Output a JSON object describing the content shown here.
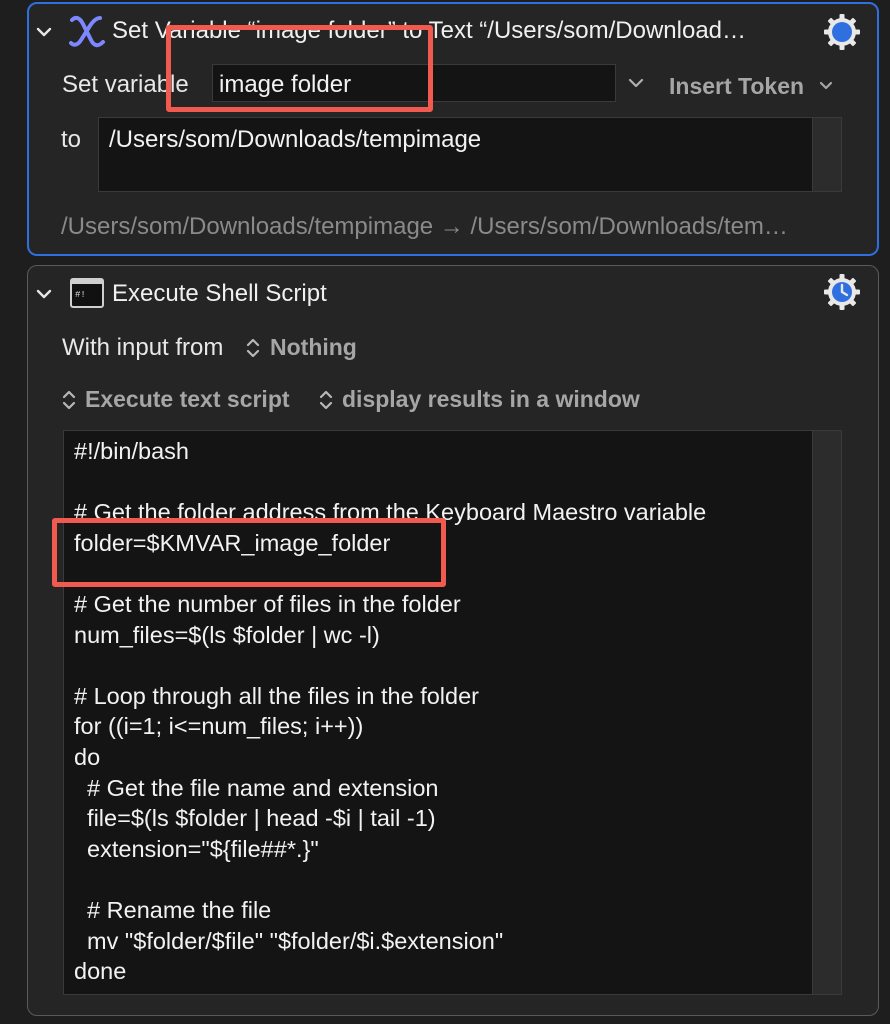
{
  "actions": [
    {
      "title": "Set Variable “image folder” to Text “/Users/som/Download…",
      "set_variable_label": "Set variable",
      "variable_value": "image folder",
      "insert_token_label": "Insert Token",
      "to_label": "to",
      "text_value": "/Users/som/Downloads/tempimage",
      "preview": "/Users/som/Downloads/tempimage → /Users/som/Downloads/tem…",
      "icon": "variable-x-icon",
      "selected": true
    },
    {
      "title": "Execute Shell Script",
      "input_label": "With input from",
      "input_value": "Nothing",
      "execute_mode": "Execute text script",
      "result_mode": "display results in a window",
      "icon": "terminal-icon",
      "script_lines": [
        "#!/bin/bash",
        "",
        "# Get the folder address from the Keyboard Maestro variable",
        "folder=$KMVAR_image_folder",
        "",
        "# Get the number of files in the folder",
        "num_files=$(ls $folder | wc -l)",
        "",
        "# Loop through all the files in the folder",
        "for ((i=1; i<=num_files; i++))",
        "do",
        "  # Get the file name and extension",
        "  file=$(ls $folder | head -$i | tail -1)",
        "  extension=\"${file##*.}\"",
        "",
        "  # Rename the file",
        "  mv \"$folder/$file\" \"$folder/$i.$extension\"",
        "done"
      ]
    }
  ],
  "colors": {
    "accent": "#2f6fe0",
    "highlight": "#f05a4f",
    "background": "#1e1e1e"
  }
}
